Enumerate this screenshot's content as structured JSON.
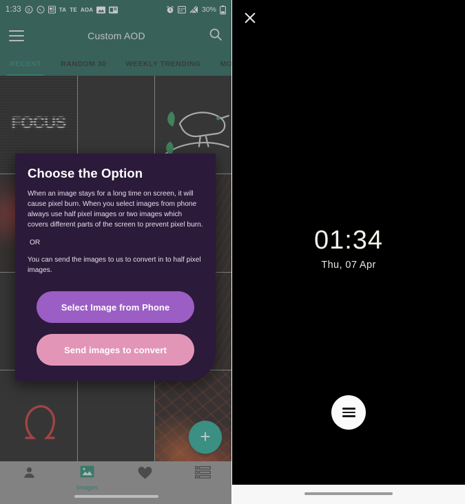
{
  "left_phone": {
    "statusbar": {
      "time": "1:33",
      "left_icons": [
        "bluetooth-circle-icon",
        "whatsapp-icon",
        "news-icon"
      ],
      "left_texts": [
        "TA",
        "TE",
        "AOA"
      ],
      "left_icons_2": [
        "image-icon",
        "card-icon"
      ],
      "right_icons": [
        "alarm-icon",
        "calendar-icon",
        "signal-icon"
      ],
      "battery_percent": "30%",
      "battery_icon": "battery-icon"
    },
    "appbar": {
      "menu_icon": "hamburger-menu-icon",
      "title": "Custom AOD",
      "search_icon": "search-icon"
    },
    "tabs": [
      {
        "label": "RECENT",
        "active": true
      },
      {
        "label": "RANDOM 30",
        "active": false
      },
      {
        "label": "WEEKLY TRENDING",
        "active": false
      },
      {
        "label": "MONTHLY TRENDING",
        "active": false
      }
    ],
    "grid": {
      "cells": [
        {
          "name": "focus-wallpaper",
          "art": "focus"
        },
        {
          "name": "blank-wallpaper",
          "art": "blank"
        },
        {
          "name": "bird-wallpaper",
          "art": "bird"
        },
        {
          "name": "red-wallpaper",
          "art": "red"
        },
        {
          "name": "dark-wallpaper",
          "art": "blank"
        },
        {
          "name": "red-streak-wallpaper",
          "art": "red2"
        },
        {
          "name": "blank-wallpaper-2",
          "art": "blank"
        },
        {
          "name": "teal-pattern-wallpaper",
          "art": "teal"
        },
        {
          "name": "red-line-wallpaper",
          "art": "red2"
        },
        {
          "name": "omega-wallpaper",
          "art": "omega"
        },
        {
          "name": "blank-wallpaper-3",
          "art": "blank"
        },
        {
          "name": "lava-wallpaper",
          "art": "lava"
        }
      ]
    },
    "fab": {
      "icon": "plus-icon",
      "label": "+",
      "color": "#11a18c"
    },
    "bottom_nav": [
      {
        "name": "person",
        "icon": "person-icon",
        "label": "",
        "active": false
      },
      {
        "name": "images",
        "icon": "images-icon",
        "label": "Images",
        "active": true
      },
      {
        "name": "favorites",
        "icon": "heart-icon",
        "label": "",
        "active": false
      },
      {
        "name": "list",
        "icon": "list-icon",
        "label": "",
        "active": false
      }
    ],
    "dialog": {
      "title": "Choose the Option",
      "body1": "When an image stays for a long time on screen, it will cause pixel burn. When you select images from phone always use half pixel images or two images which covers different parts of the screen to prevent pixel burn.",
      "or": "OR",
      "body2": "You can send the images to us to convert in to half pixel images.",
      "primary_button": "Select Image from Phone",
      "secondary_button": "Send images to convert",
      "bg_color": "#2b1a3a",
      "primary_color": "#9b5ec4",
      "secondary_color": "#e395b8"
    }
  },
  "right_phone": {
    "close_icon": "close-icon",
    "clock": {
      "time": "01:34",
      "date": "Thu, 07 Apr"
    },
    "fab": {
      "icon": "hamburger-menu-icon"
    },
    "wallpaper": {
      "name": "geometric-diamond-pattern",
      "colors": [
        "#0e7a68",
        "#c9a227",
        "#000000"
      ]
    }
  }
}
